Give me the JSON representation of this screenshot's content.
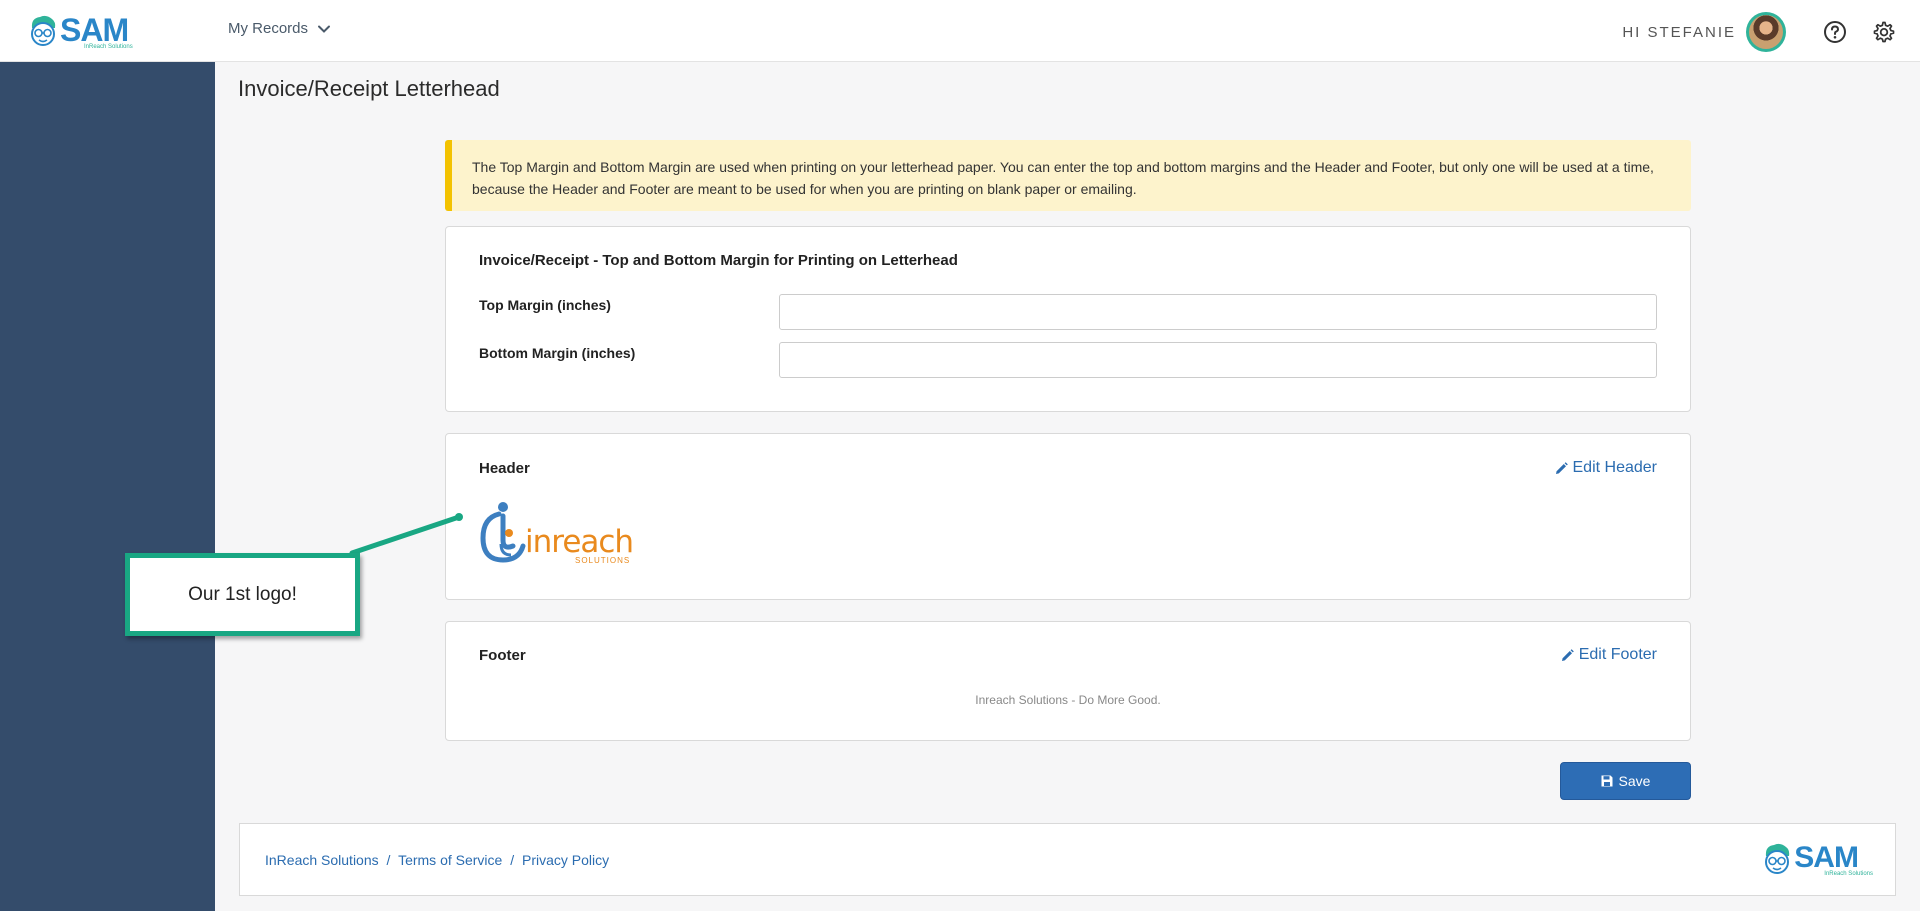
{
  "topbar": {
    "brand_name": "SAM",
    "brand_sub": "InReach Solutions",
    "nav_records": "My Records",
    "greeting": "HI STEFANIE"
  },
  "page": {
    "title": "Invoice/Receipt Letterhead"
  },
  "notice": {
    "text": "The Top Margin and Bottom Margin are used when printing on your letterhead paper. You can enter the top and bottom margins and the Header and Footer, but only one will be used at a time, because the Header and Footer are meant to be used for when you are printing on blank paper or emailing."
  },
  "margins_card": {
    "title": "Invoice/Receipt - Top and Bottom Margin for Printing on Letterhead",
    "top_label": "Top Margin (inches)",
    "top_value": "",
    "bottom_label": "Bottom Margin (inches)",
    "bottom_value": ""
  },
  "header_card": {
    "title": "Header",
    "edit_label": "Edit Header",
    "logo_text": "inreach",
    "logo_sub": "SOLUTIONS"
  },
  "footer_card": {
    "title": "Footer",
    "edit_label": "Edit Footer",
    "footer_text": "Inreach Solutions - Do More Good."
  },
  "actions": {
    "save_label": "Save"
  },
  "page_footer": {
    "link_company": "InReach Solutions",
    "link_terms": "Terms of Service",
    "link_privacy": "Privacy Policy",
    "separator": "/",
    "brand_name": "SAM",
    "brand_sub": "InReach Solutions"
  },
  "callout": {
    "text": "Our 1st logo!"
  },
  "colors": {
    "brand_blue": "#2a86c8",
    "brand_teal": "#2fb39a",
    "sidebar": "#344c6b",
    "notice_bg": "#fdf3cc",
    "notice_accent": "#f3c200",
    "link": "#2b6cb0",
    "save_button": "#2d6db5",
    "callout_border": "#19a783",
    "logo_blue": "#3d7fc0",
    "logo_orange": "#e98a1e"
  }
}
